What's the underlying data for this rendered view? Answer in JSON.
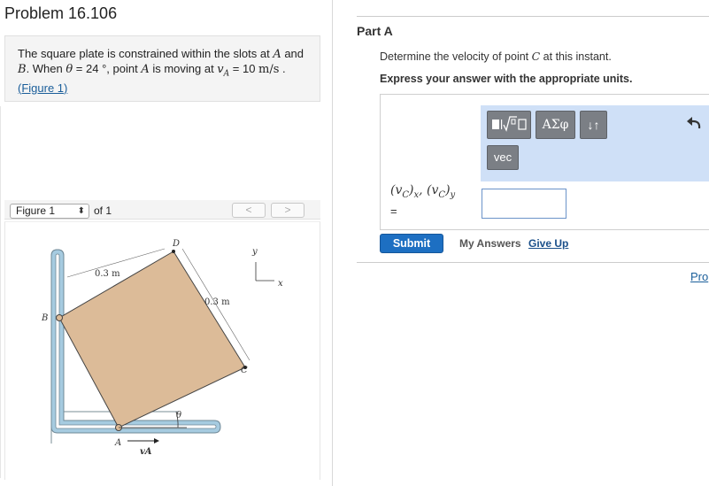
{
  "problem": {
    "title": "Problem 16.106",
    "text_before_A": "The square plate is constrained within the slots at ",
    "point_A": "A",
    "text_and": " and",
    "point_B": "B",
    "text_when": ". When ",
    "theta": "θ",
    "text_angle": " = 24 °, point ",
    "point_A2": "A",
    "text_moving": " is moving at ",
    "velocity_symbol": "v",
    "velocity_sub": "A",
    "text_speed": " = 10 ",
    "units": "m/s",
    "text_end": " .",
    "figure_link": "(Figure 1)"
  },
  "figure_nav": {
    "selected": "Figure 1",
    "of_label": "of 1",
    "prev_label": "<",
    "next_label": ">"
  },
  "figure": {
    "label_D": "D",
    "label_y": "y",
    "label_x": "x",
    "label_03m_top": "0.3 m",
    "label_03m_right": "0.3 m",
    "label_B": "B",
    "label_C": "C",
    "label_theta": "θ",
    "label_A": "A",
    "label_vA": "vA"
  },
  "part": {
    "label": "Part A",
    "question_before": "Determine the velocity of point ",
    "question_point": "C",
    "question_after": " at this instant.",
    "instruction": "Express your answer with the appropriate units."
  },
  "toolbar": {
    "greek_label": "ΑΣφ",
    "updown_label": "↓↑",
    "vec_label": "vec"
  },
  "answer": {
    "label_v1": "(v",
    "label_sub1": "C",
    "label_close1": ")",
    "label_sub_x": "x",
    "label_comma": ", ",
    "label_v2": "(v",
    "label_sub2": "C",
    "label_close2": ")",
    "label_sub_y": "y",
    "equals": "=",
    "value": ""
  },
  "actions": {
    "submit": "Submit",
    "my_answers": "My Answers",
    "give_up": "Give Up",
    "pro_link": "Pro"
  },
  "colors": {
    "plate": "#dcbb98",
    "slot": "#a6cbe0",
    "toolbar_bg": "#cfe0f7",
    "submit_bg": "#1d6fc2",
    "link": "#1a5e9a"
  }
}
